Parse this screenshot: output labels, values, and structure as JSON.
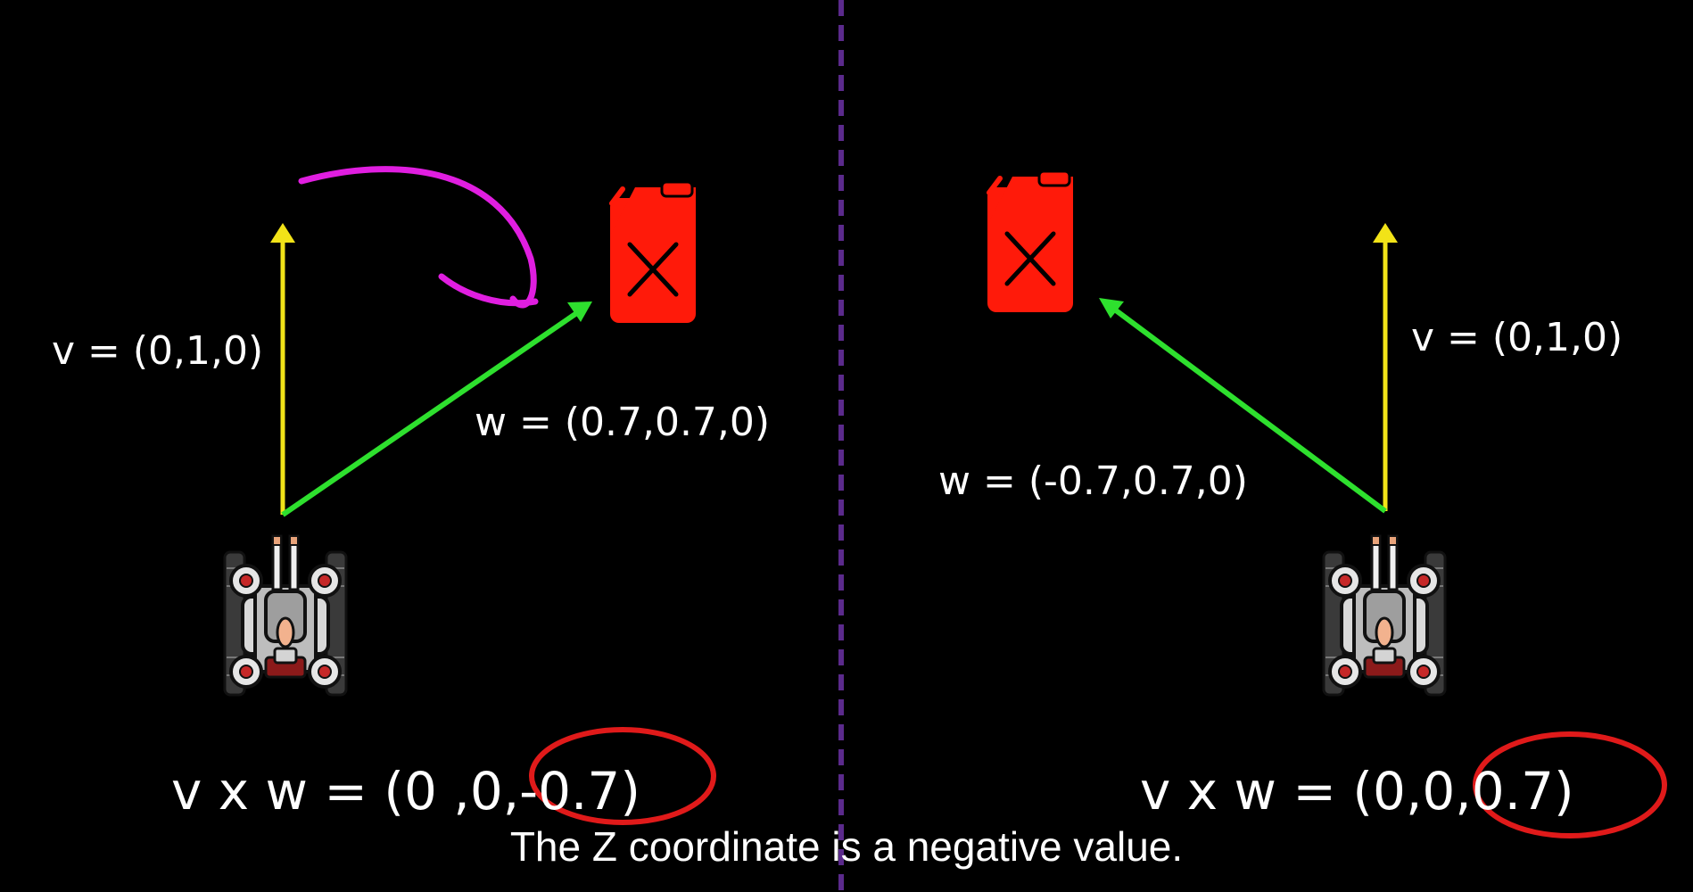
{
  "colors": {
    "background": "#000000",
    "vector_v": "#f2e318",
    "vector_w": "#2ee02e",
    "divider": "#5b2a8c",
    "rotation_arc": "#e01ee0",
    "highlight_circle": "#e01a1a",
    "fuel_can": "#ff1a0a",
    "text": "#ffffff"
  },
  "left_panel": {
    "v_label": "v = (0,1,0)",
    "w_label": "w = (0.7,0.7,0)",
    "result": "v x w = (0 ,0,-0.7)",
    "icons": [
      "tank-icon",
      "fuel-can-icon",
      "rotation-arc"
    ]
  },
  "right_panel": {
    "v_label": "v = (0,1,0)",
    "w_label": "w = (-0.7,0.7,0)",
    "result": "v x w = (0,0,0.7)",
    "icons": [
      "tank-icon",
      "fuel-can-icon"
    ]
  },
  "subtitle": "The Z coordinate is a negative value."
}
